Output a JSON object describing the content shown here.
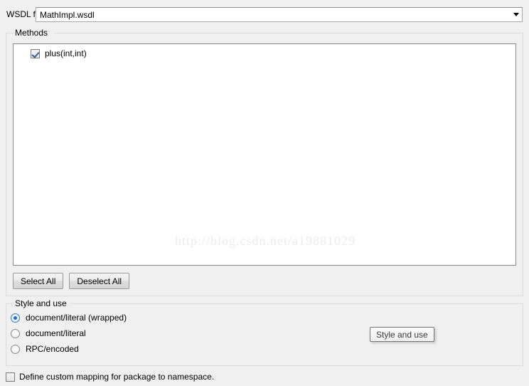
{
  "wsdl": {
    "label": "WSDL file:",
    "selected_value": "MathImpl.wsdl",
    "dropdown_icon": "chevron-down-icon"
  },
  "methods": {
    "legend": "Methods",
    "items": [
      {
        "label": "plus(int,int)",
        "checked": true
      }
    ],
    "watermark": "http://blog.csdn.net/a19881029",
    "select_all_label": "Select All",
    "deselect_all_label": "Deselect All"
  },
  "style_and_use": {
    "legend": "Style and use",
    "options": [
      {
        "label": "document/literal (wrapped)",
        "selected": true
      },
      {
        "label": "document/literal",
        "selected": false
      },
      {
        "label": "RPC/encoded",
        "selected": false
      }
    ]
  },
  "custom_mapping": {
    "label": "Define custom mapping for package to namespace.",
    "checked": false
  },
  "tooltip": {
    "text": "Style and use"
  },
  "colors": {
    "window_background": "#f0f0f0",
    "field_background": "#ffffff",
    "group_border": "#dcdcdc",
    "list_border": "#898989",
    "radio_accent": "#1f6fc4",
    "check_accent": "#31609c",
    "watermark": "#ececec"
  }
}
